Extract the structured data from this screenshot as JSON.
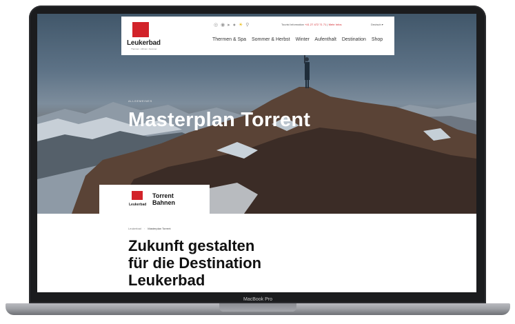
{
  "device": {
    "brand": "MacBook Pro"
  },
  "header": {
    "logo_text": "Leukerbad",
    "logo_sub": "Thermen • Winter • Sommer",
    "icons": [
      "instagram-icon",
      "facebook-icon",
      "youtube-icon",
      "twitter-icon",
      "weather-icon",
      "search-icon"
    ],
    "contact_label": "Tourist Information",
    "contact_phone": "+41 27 472 71 71",
    "contact_sep": " | ",
    "contact_link": "Mehr Infos",
    "language": "Deutsch ▾",
    "nav": [
      "Thermen & Spa",
      "Sommer & Herbst",
      "Winter",
      "Aufenthalt",
      "Destination",
      "Shop"
    ]
  },
  "hero": {
    "kicker": "ALLGEMEINES",
    "title": "Masterplan Torrent"
  },
  "partner": {
    "logo_small": "Leukerbad",
    "name_line1": "Torrent",
    "name_line2": "Bahnen"
  },
  "breadcrumb": {
    "home": "Leukerbad",
    "sep": "›",
    "current": "Masterplan Torrent"
  },
  "headline": {
    "line1": "Zukunft gestalten",
    "line2": "für die Destination",
    "line3": "Leukerbad"
  }
}
